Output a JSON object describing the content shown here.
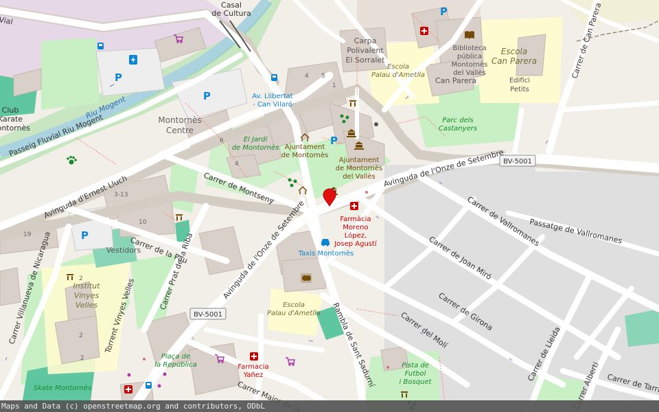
{
  "attribution": "Maps and Data (c) openstreetmap.org and contributors, ODbL",
  "colors": {
    "background": "#f2efe9",
    "road": "#ffffff",
    "road_casing": "#d3cdc4",
    "building": "#d9d0c9",
    "park": "#c8f0c4",
    "sport": "#8ad4b8",
    "school": "#fffbd0",
    "residential": "#e0dfdf",
    "river": "#aad3df",
    "poi_blue": "#0e85d4",
    "poi_red": "#c80000",
    "poi_brown": "#734a08",
    "marker": "#e31010"
  },
  "labels": {
    "vial": "Vial",
    "casal1": "Casal",
    "casal2": "de Cultura",
    "carpa1": "Carpa",
    "carpa2": "Polivalent",
    "carpa3": "El Sorralet",
    "escola_pa1": "Escola",
    "escola_pa2": "Palau d'Ametlla",
    "biblio1": "Biblioteca",
    "biblio2": "pública",
    "biblio3": "Montornès",
    "biblio4": "del Vallès",
    "canparera_school1": "Escola",
    "canparera_school2": "Can Parera",
    "canparera": "Can Parera",
    "edifici1": "Edifici",
    "edifici2": "Petits",
    "carrer_can_parera": "Carrer de Can Parera",
    "riu_mogent": "Riu Mogent",
    "passeig": "Passeig Fluvial Riu Mogent",
    "club1": "Club",
    "club2": "Karate",
    "club3": "Montornès",
    "av_llibertat1": "Av. Llibertat",
    "av_llibertat2": "- Can Vilaró",
    "montornes_centre1": "Montornès",
    "montornes_centre2": "Centre",
    "jardi1": "El Jardí",
    "jardi2": "de Montornès",
    "ajuntament_a1": "Ajuntament",
    "ajuntament_a2": "de Montornès",
    "ajuntament_b1": "Ajuntament",
    "ajuntament_b2": "de Montornès",
    "ajuntament_b3": "del Vallès",
    "parc1": "Parc dels",
    "parc2": "Castanyers",
    "av_onze_north": "Avinguda de l'Onze de Setembre",
    "av_onze_south": "Avinguda de l'Onze de Setembre",
    "bv5001_east": "BV-5001",
    "bv5001_west": "BV-5001",
    "av_ernest": "Avinguda d'Ernest Lluch",
    "carrer_montseny": "Carrer de Montseny",
    "carrer_vallromanes": "Carrer de Vallromanes",
    "passatge_vallromanes": "Passatge de Vallromanes",
    "farmacia_moreno1": "Farmàcia",
    "farmacia_moreno2": "Moreno",
    "farmacia_moreno3": "López,",
    "farmacia_moreno4": "Josep Agustí",
    "taxis": "Taxis Montornès",
    "carrer_joan_miro": "Carrer de Joan Miró",
    "carrer_girona": "Carrer de Girona",
    "carrer_moli": "Carrer del Molí",
    "carrer_lleida": "Carrer de Lleida",
    "carrer_tarragona": "Carrer de Tarrag",
    "carrer_alberti": "Carrer Alberti",
    "carrer_pau": "Carrer de la Pau",
    "carrer_prat": "Carrer Prat de la Riba",
    "carrer_nicaragua": "Carrer Villanueva de Nicaragua",
    "torrent": "Torrent Vinyes Velles",
    "institut1": "Institut",
    "institut2": "Vinyes",
    "institut3": "Velles",
    "vestidors": "Vestidors",
    "escola_pa_s1": "Escola",
    "escola_pa_s2": "Palau d'Ametlla",
    "rambla": "Rambla de Sant Sadurní",
    "placa1": "Plaça de",
    "placa2": "la República",
    "farmacia_yanez1": "Farmacia",
    "farmacia_yanez2": "Yañez",
    "carrer_major": "Carrer Major de la Lira",
    "pista1": "Pista de",
    "pista2": "Futbol",
    "pista3": "i Bosquet",
    "skate": "Skate Montornès",
    "n4": "4",
    "n5": "5",
    "n1": "1",
    "n6": "6",
    "n4b": "4",
    "n313": "3-13",
    "n10": "10",
    "n19": "19",
    "n2a": "2",
    "n2b": "2",
    "n2c": "2"
  },
  "icons": {
    "parking": "P",
    "shop": "shop-cart-icon",
    "bus": "bus-stop-icon",
    "pharmacy": "pharmacy-cross-icon",
    "library": "library-book-icon",
    "townhall": "town-hall-icon",
    "taxi": "taxi-icon",
    "theatre": "theatre-masks-icon",
    "playground": "playground-icon",
    "dog_park": "dog-park-icon",
    "charging": "charging-station-icon"
  }
}
